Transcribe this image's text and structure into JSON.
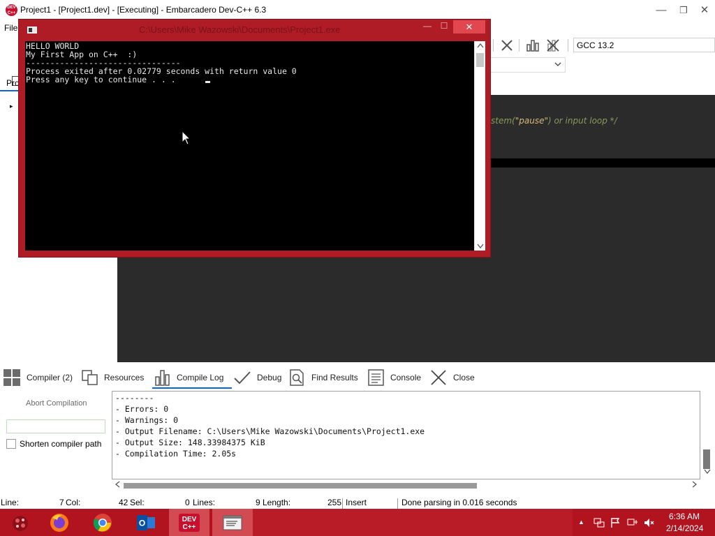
{
  "window": {
    "title": "Project1 - [Project1.dev] - [Executing] - Embarcadero Dev-C++ 6.3",
    "icon_label": "DEV C++",
    "minimize": "—",
    "maximize": "❐",
    "close": "✕"
  },
  "menu": {
    "file": "File"
  },
  "toolbar": {
    "compiler": "GCC 13.2"
  },
  "left_panel": {
    "tab": "Pro",
    "tree_expand": "▸"
  },
  "editor": {
    "comment_prefix": "stem(",
    "comment_string": "\"pause\"",
    "comment_suffix": ") or input loop */"
  },
  "console": {
    "title": "C:\\Users\\Mike Wazowski\\Documents\\Project1.exe",
    "minimize": "—",
    "maximize": "☐",
    "close": "✕",
    "lines": [
      "HELLO WORLD",
      "My First App on C++  :)",
      "--------------------------------",
      "Process exited after 0.02779 seconds with return value 0",
      "Press any key to continue . . . "
    ]
  },
  "bottom_tabs": {
    "compiler": "Compiler (2)",
    "resources": "Resources",
    "compile_log": "Compile Log",
    "debug": "Debug",
    "find_results": "Find Results",
    "console": "Console",
    "close": "Close"
  },
  "compile_panel": {
    "abort_label": "Abort Compilation",
    "shorten_label": "Shorten compiler path",
    "shorten_checked": false
  },
  "compile_log": [
    "--------",
    "- Errors: 0",
    "- Warnings: 0",
    "- Output Filename: C:\\Users\\Mike Wazowski\\Documents\\Project1.exe",
    "- Output Size: 148.33984375 KiB",
    "- Compilation Time: 2.05s"
  ],
  "statusbar": {
    "line_label": "Line:",
    "line_value": "7",
    "col_label": "Col:",
    "col_value": "42",
    "sel_label": "Sel:",
    "sel_value": "0",
    "lines_label": "Lines:",
    "lines_value": "9",
    "length_label": "Length:",
    "length_value": "255",
    "mode": "Insert",
    "message": "Done parsing in 0.016 seconds"
  },
  "taskbar": {
    "apps": [
      "firefox-icon",
      "chrome-icon",
      "outlook-icon",
      "devcpp-icon",
      "console-window-icon"
    ],
    "devcpp_label": "DEV C++",
    "time": "6:36 AM",
    "date": "2/14/2024",
    "show_hidden": "▲"
  },
  "colors": {
    "console_frame": "#b01c26",
    "taskbar": "#b2141f",
    "editor_bg": "#2b2b2b",
    "accent": "#0a64d8"
  }
}
